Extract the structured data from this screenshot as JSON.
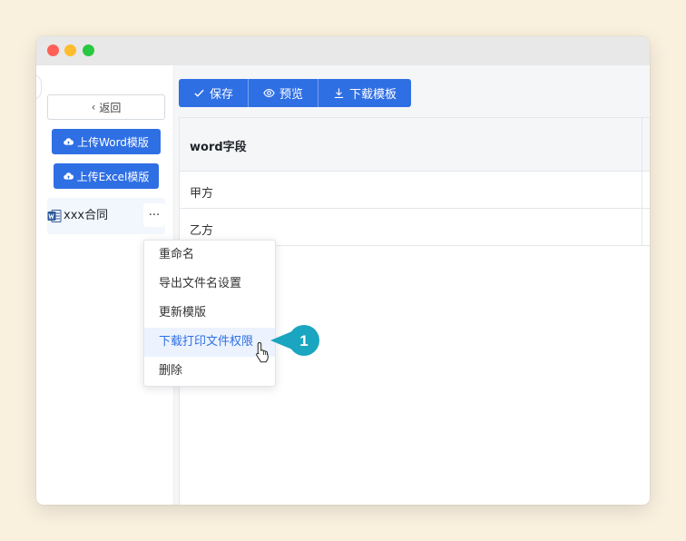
{
  "sidebar": {
    "back_label": "返回",
    "upload_word_label": "上传Word模版",
    "upload_excel_label": "上传Excel模版",
    "file_name": "xxx合同",
    "more_label": "···"
  },
  "toolbar": {
    "save_label": "保存",
    "preview_label": "预览",
    "download_label": "下载模板"
  },
  "table": {
    "header": "word字段",
    "rows": [
      "甲方",
      "乙方"
    ]
  },
  "context_menu": {
    "items": [
      "重命名",
      "导出文件名设置",
      "更新模版",
      "下载打印文件权限",
      "删除"
    ],
    "active_index": 3
  },
  "callout": {
    "step": "1",
    "color": "#1aa5c0"
  },
  "colors": {
    "primary": "#2f6fe4",
    "background": "#f9f0de"
  }
}
